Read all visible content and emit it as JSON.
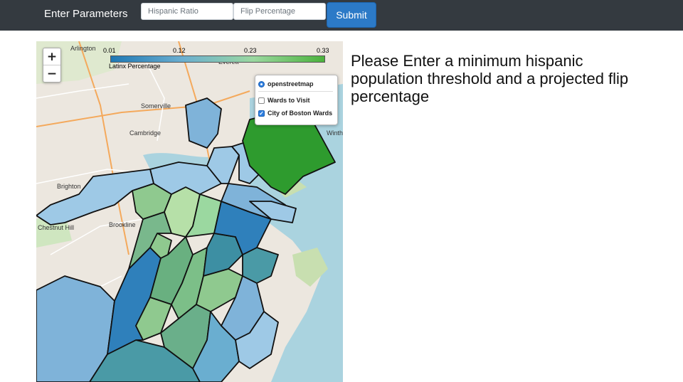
{
  "navbar": {
    "brand": "Enter Parameters",
    "hispanic_placeholder": "Hispanic Ratio",
    "flip_placeholder": "Flip Percentage",
    "submit_label": "Submit"
  },
  "map": {
    "zoom_in": "+",
    "zoom_out": "−",
    "legend": {
      "ticks": [
        "0.01",
        "0.12",
        "0.23",
        "0.33"
      ],
      "caption": "Latinx Percentage",
      "colors": [
        "#1f78b4",
        "#6aaed0",
        "#9bd8a0",
        "#4bb23c"
      ]
    },
    "layer_control": {
      "base_layer": "openstreetmap",
      "overlays": [
        {
          "label": "Wards to Visit",
          "checked": false
        },
        {
          "label": "City of Boston Wards",
          "checked": true
        }
      ]
    },
    "place_labels": [
      "Arlington",
      "Everett",
      "Somerville",
      "Cambridge",
      "Brighton",
      "Brookline",
      "Chestnut Hill",
      "Winthrop"
    ],
    "place_labels_visible": [
      "Arlington",
      "Everett",
      "Somerville",
      "Cambridge",
      "Brighton",
      "Brookline",
      "Chestnut Hill",
      "Winth"
    ]
  },
  "main": {
    "heading": "Please Enter a minimum hispanic population threshold and a projected flip percentage"
  }
}
